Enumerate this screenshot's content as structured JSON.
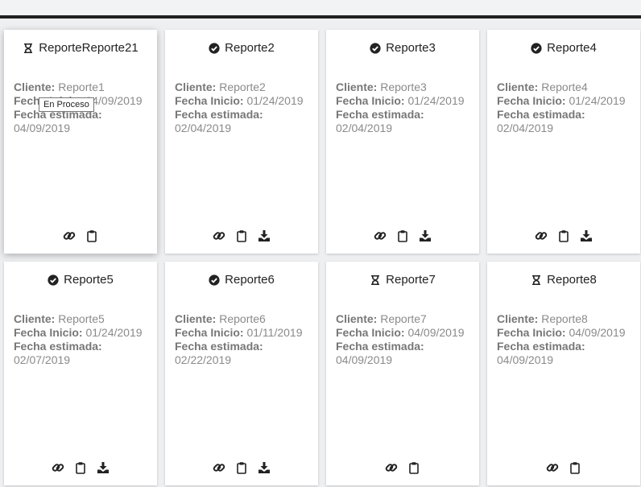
{
  "cards": [
    {
      "title": "ReporteReporte21",
      "status": "in-progress",
      "cliente_label": "Cliente:",
      "cliente": "Reporte1",
      "inicio_label": "Fecha Inicio:",
      "inicio": "04/09/2019",
      "estimada_label": "Fecha estimada:",
      "estimada": "04/09/2019",
      "actions": [
        "link",
        "clipboard"
      ]
    },
    {
      "title": "Reporte2",
      "status": "done",
      "cliente_label": "Cliente:",
      "cliente": "Reporte2",
      "inicio_label": "Fecha Inicio:",
      "inicio": "01/24/2019",
      "estimada_label": "Fecha estimada:",
      "estimada": "02/04/2019",
      "actions": [
        "link",
        "clipboard",
        "download"
      ]
    },
    {
      "title": "Reporte3",
      "status": "done",
      "cliente_label": "Cliente:",
      "cliente": "Reporte3",
      "inicio_label": "Fecha Inicio:",
      "inicio": "01/24/2019",
      "estimada_label": "Fecha estimada:",
      "estimada": "02/04/2019",
      "actions": [
        "link",
        "clipboard",
        "download"
      ]
    },
    {
      "title": "Reporte4",
      "status": "done",
      "cliente_label": "Cliente:",
      "cliente": "Reporte4",
      "inicio_label": "Fecha Inicio:",
      "inicio": "01/24/2019",
      "estimada_label": "Fecha estimada:",
      "estimada": "02/04/2019",
      "actions": [
        "link",
        "clipboard",
        "download"
      ]
    },
    {
      "title": "Reporte5",
      "status": "done",
      "cliente_label": "Cliente:",
      "cliente": "Reporte5",
      "inicio_label": "Fecha Inicio:",
      "inicio": "01/24/2019",
      "estimada_label": "Fecha estimada:",
      "estimada": "02/07/2019",
      "actions": [
        "link",
        "clipboard",
        "download"
      ]
    },
    {
      "title": "Reporte6",
      "status": "done",
      "cliente_label": "Cliente:",
      "cliente": "Reporte6",
      "inicio_label": "Fecha Inicio:",
      "inicio": "01/11/2019",
      "estimada_label": "Fecha estimada:",
      "estimada": "02/22/2019",
      "actions": [
        "link",
        "clipboard",
        "download"
      ]
    },
    {
      "title": "Reporte7",
      "status": "in-progress",
      "cliente_label": "Cliente:",
      "cliente": "Reporte7",
      "inicio_label": "Fecha Inicio:",
      "inicio": "04/09/2019",
      "estimada_label": "Fecha estimada:",
      "estimada": "04/09/2019",
      "actions": [
        "link",
        "clipboard"
      ]
    },
    {
      "title": "Reporte8",
      "status": "in-progress",
      "cliente_label": "Cliente:",
      "cliente": "Reporte8",
      "inicio_label": "Fecha Inicio:",
      "inicio": "04/09/2019",
      "estimada_label": "Fecha estimada:",
      "estimada": "04/09/2019",
      "actions": [
        "link",
        "clipboard"
      ]
    }
  ],
  "tooltip": {
    "text": "En Proceso"
  },
  "status_icons": {
    "done": "check-circle-icon",
    "in-progress": "hourglass-icon"
  },
  "action_icons": {
    "link": "link-icon",
    "clipboard": "clipboard-icon",
    "download": "download-icon"
  },
  "colors": {
    "icon": "#222222",
    "label": "#777777",
    "value": "#8a8a8a",
    "background": "#eeeff1"
  }
}
